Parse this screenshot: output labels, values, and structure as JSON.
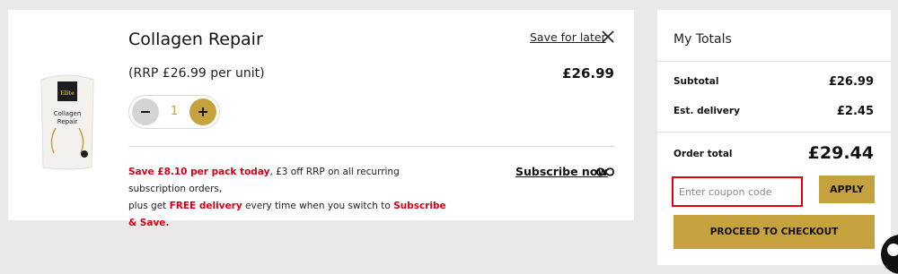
{
  "cart_item": {
    "title": "Collagen Repair",
    "save_for_later": "Save for later",
    "rrp": "(RRP £26.99 per unit)",
    "price": "£26.99",
    "quantity": "1",
    "image": {
      "brand": "Elite",
      "name_line1": "Collagen",
      "name_line2": "Repair"
    },
    "promo": {
      "highlight1": "Save £8.10 per pack today",
      "text1": ", £3 off RRP on all recurring subscription orders,",
      "text2": "plus get ",
      "highlight2": "FREE delivery",
      "text3": " every time when you switch to ",
      "highlight3": "Subscribe & Save."
    },
    "subscribe_label": "Subscribe now"
  },
  "totals": {
    "title": "My Totals",
    "subtotal_label": "Subtotal",
    "subtotal_value": "£26.99",
    "delivery_label": "Est. delivery",
    "delivery_value": "£2.45",
    "order_total_label": "Order total",
    "order_total_value": "£29.44",
    "coupon_placeholder": "Enter coupon code",
    "apply_label": "APPLY",
    "checkout_label": "PROCEED TO CHECKOUT"
  },
  "colors": {
    "accent": "#c6a23f",
    "promo_red": "#d4001a",
    "input_border": "#e10012"
  }
}
